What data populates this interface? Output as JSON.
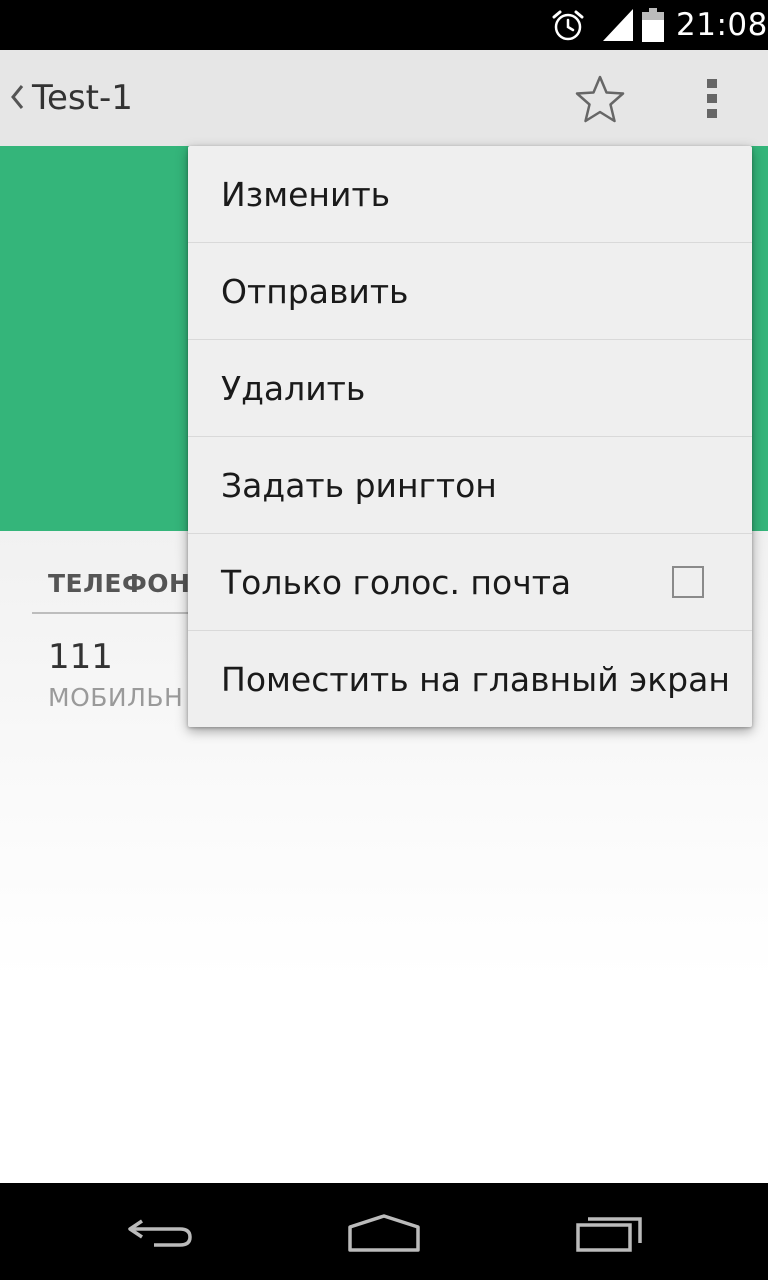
{
  "status_bar": {
    "time": "21:08",
    "icons": [
      "alarm-icon",
      "signal-icon",
      "battery-icon"
    ]
  },
  "action_bar": {
    "title": "Test-1",
    "icons": [
      "back-chevron-icon",
      "star-icon",
      "overflow-menu-icon"
    ]
  },
  "header": {
    "color": "#34b57a"
  },
  "contact": {
    "section_label": "ТЕЛЕФОН",
    "phone_number": "111",
    "phone_type": "МОБИЛЬН"
  },
  "menu": {
    "items": [
      {
        "label": "Изменить"
      },
      {
        "label": "Отправить"
      },
      {
        "label": "Удалить"
      },
      {
        "label": "Задать рингтон"
      },
      {
        "label": "Только голос. почта",
        "checkbox": true,
        "checked": false
      },
      {
        "label": "Поместить на главный экран"
      }
    ]
  },
  "nav_bar": {
    "icons": [
      "back-icon",
      "home-icon",
      "recent-apps-icon"
    ]
  }
}
